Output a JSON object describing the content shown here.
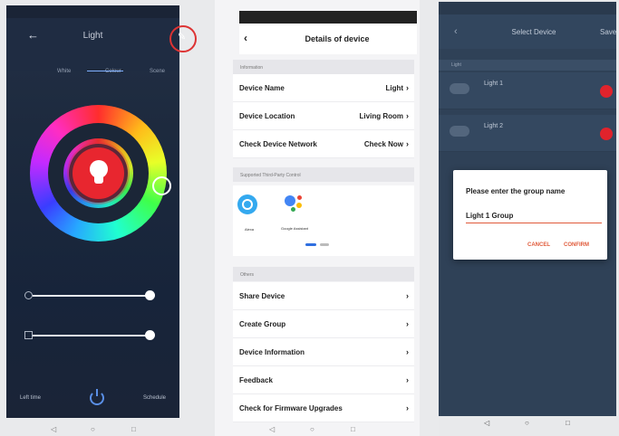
{
  "screen1": {
    "status_left": "",
    "status_right": "",
    "title": "Light",
    "tabs": [
      "White",
      "Colour",
      "Scene"
    ],
    "slider_brightness_value": 1.0,
    "slider_temperature_value": 1.0,
    "slider_brightness_label": "",
    "slider_temperature_label": "",
    "bottom_left": "Left time",
    "bottom_right": "Schedule",
    "colors": {
      "accent": "#5a8fe6",
      "highlight": "#d33333"
    }
  },
  "screen2": {
    "status_left": "",
    "status_right": "",
    "title": "Details of device",
    "section_information": "Information",
    "rows_information": [
      {
        "label": "Device Name",
        "value": "Light"
      },
      {
        "label": "Device Location",
        "value": "Living Room"
      },
      {
        "label": "Check Device Network",
        "value": "Check Now"
      }
    ],
    "section_third_party": "Supported Third-Party Control",
    "third_party": [
      {
        "name": "Alexa",
        "icon": "alexa-icon"
      },
      {
        "name": "Google Assistant",
        "icon": "google-assistant-icon"
      }
    ],
    "section_others": "Others",
    "rows_others": [
      {
        "label": "Share Device"
      },
      {
        "label": "Create Group"
      },
      {
        "label": "Device Information"
      },
      {
        "label": "Feedback"
      },
      {
        "label": "Check for Firmware Upgrades"
      }
    ]
  },
  "screen3": {
    "status_left": "",
    "status_right": "",
    "title": "Select Device",
    "save": "Save",
    "section": "Light",
    "devices": [
      {
        "name": "Light 1",
        "sub": ""
      },
      {
        "name": "Light 2",
        "sub": ""
      }
    ],
    "dialog": {
      "title": "Please enter the group name",
      "input_value": "Light 1 Group",
      "cancel": "CANCEL",
      "confirm": "CONFIRM"
    }
  },
  "nav": {
    "back_icon": "◁",
    "home_icon": "○",
    "recent_icon": "□"
  }
}
